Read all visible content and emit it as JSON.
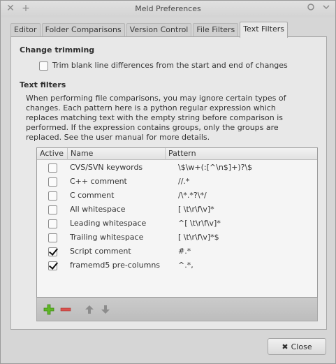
{
  "window": {
    "title": "Meld Preferences"
  },
  "tabs": [
    {
      "label": "Editor"
    },
    {
      "label": "Folder Comparisons"
    },
    {
      "label": "Version Control"
    },
    {
      "label": "File Filters"
    },
    {
      "label": "Text Filters",
      "active": true
    }
  ],
  "change_trimming": {
    "heading": "Change trimming",
    "option_label": "Trim blank line differences from the start and end of changes",
    "checked": false
  },
  "text_filters": {
    "heading": "Text filters",
    "description_lines": [
      "When performing file comparisons, you may ignore certain types of",
      "changes. Each pattern here is a python regular expression which",
      "replaces matching text with the empty string before comparison is",
      "performed. If the expression contains groups, only the groups are",
      "replaced. See the user manual for more details."
    ],
    "columns": {
      "active": "Active",
      "name": "Name",
      "pattern": "Pattern"
    },
    "rows": [
      {
        "active": false,
        "name": "CVS/SVN keywords",
        "pattern": "\\$\\w+(:[^\\n$]+)?\\$"
      },
      {
        "active": false,
        "name": "C++ comment",
        "pattern": "//.*"
      },
      {
        "active": false,
        "name": "C comment",
        "pattern": "/\\*.*?\\*/"
      },
      {
        "active": false,
        "name": "All whitespace",
        "pattern": "[ \\t\\r\\f\\v]*"
      },
      {
        "active": false,
        "name": "Leading whitespace",
        "pattern": "^[ \\t\\r\\f\\v]*"
      },
      {
        "active": false,
        "name": "Trailing whitespace",
        "pattern": "[ \\t\\r\\f\\v]*$"
      },
      {
        "active": true,
        "name": "Script comment",
        "pattern": "#.*"
      },
      {
        "active": true,
        "name": "framemd5 pre-columns",
        "pattern": "^.*,"
      }
    ]
  },
  "toolbar": {
    "add_icon": "plus-icon",
    "remove_icon": "minus-icon",
    "move_up_icon": "arrow-up-icon",
    "move_down_icon": "arrow-down-icon",
    "add_color": "#5fb626",
    "remove_color": "#d9534f"
  },
  "footer": {
    "close_label": "Close"
  }
}
